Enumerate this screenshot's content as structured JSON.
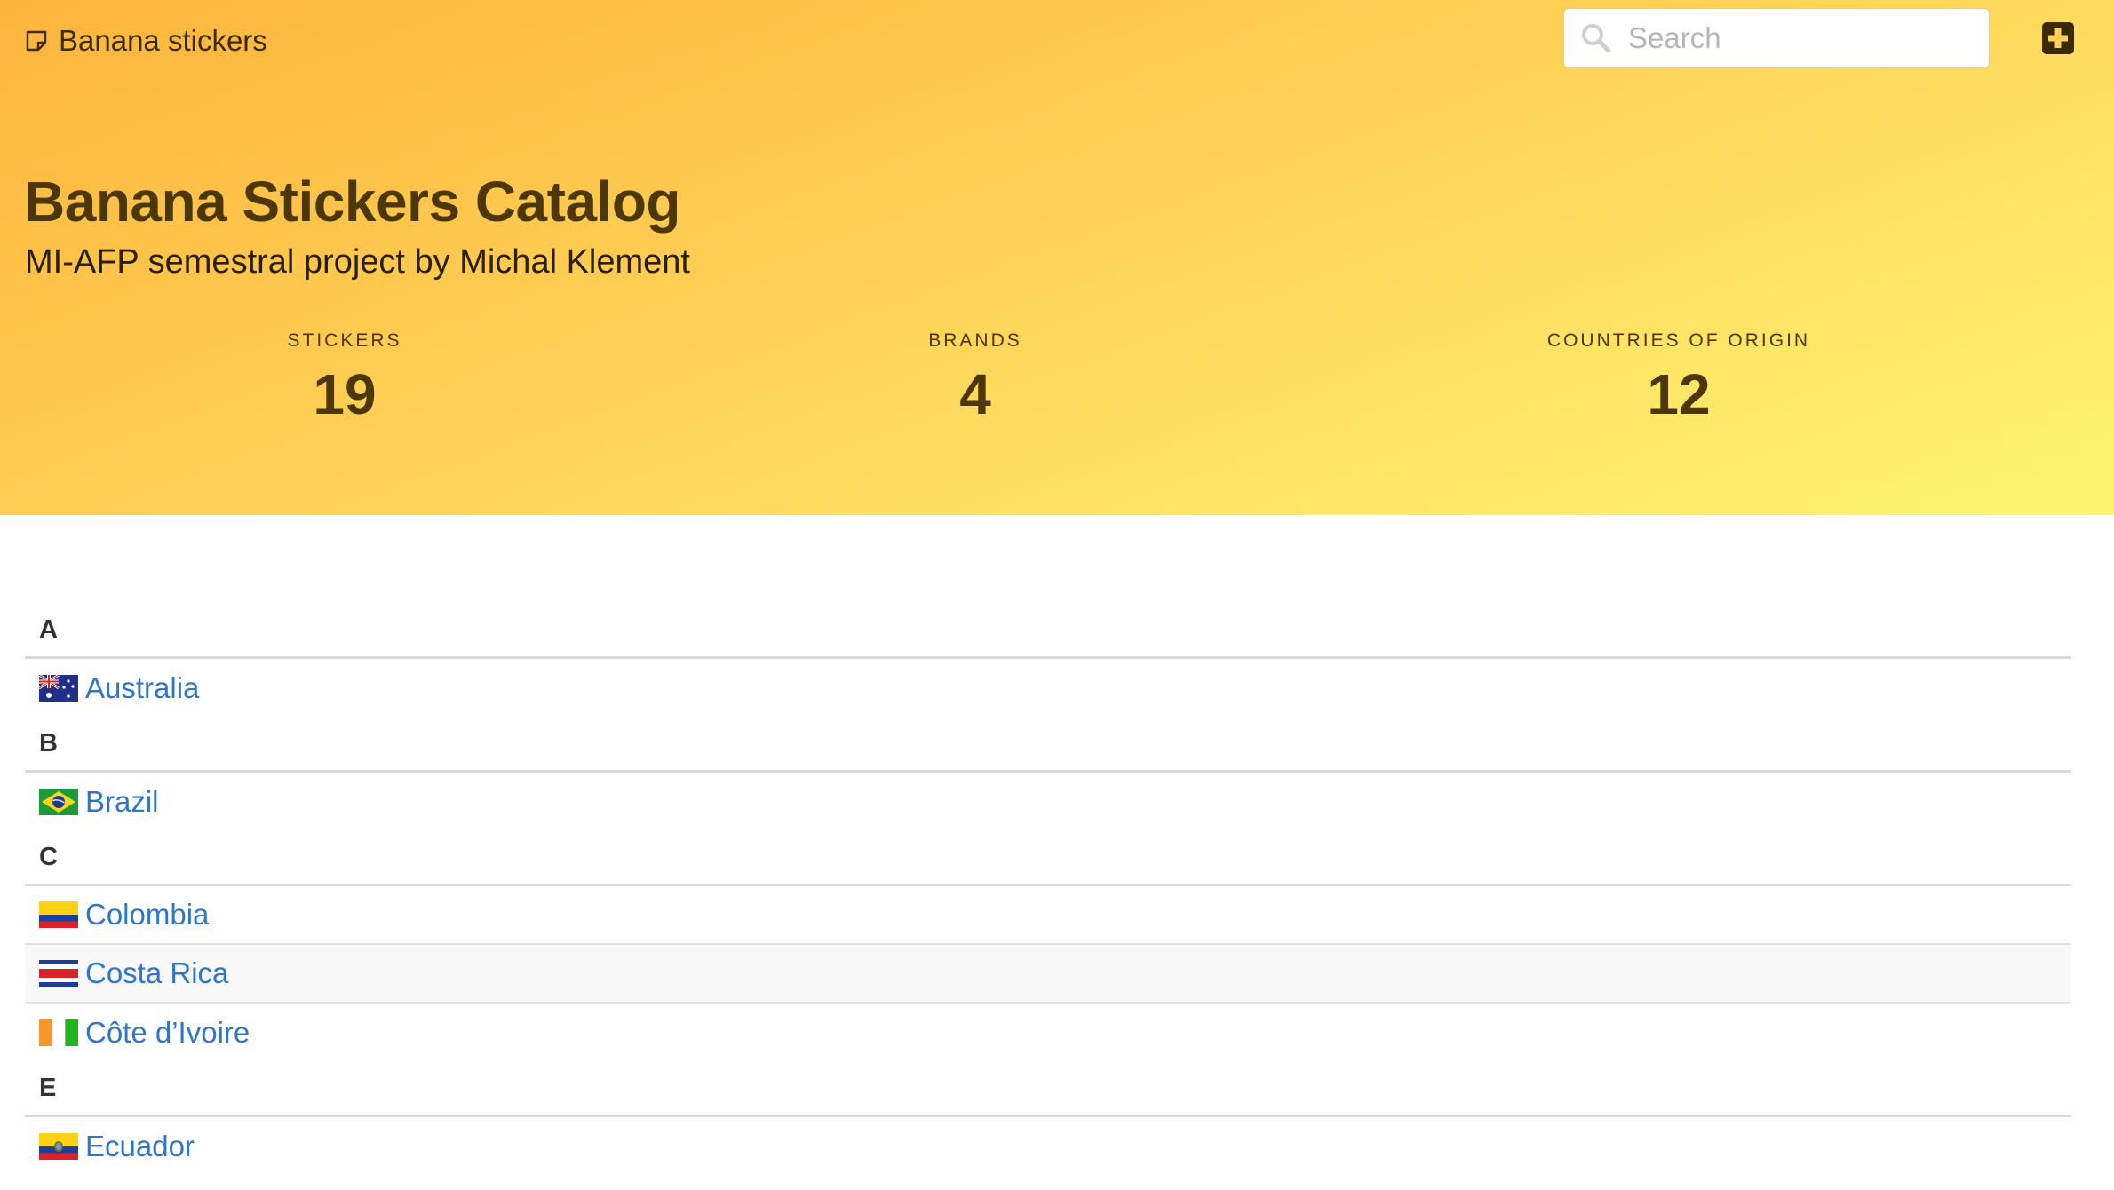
{
  "app": {
    "brand_title": "Banana stickers"
  },
  "search": {
    "placeholder": "Search"
  },
  "hero": {
    "title": "Banana Stickers Catalog",
    "subtitle": "MI-AFP semestral project by Michal Klement"
  },
  "stats": [
    {
      "label": "STICKERS",
      "value": "19"
    },
    {
      "label": "BRANDS",
      "value": "4"
    },
    {
      "label": "COUNTRIES OF ORIGIN",
      "value": "12"
    }
  ],
  "groups": [
    {
      "letter": "A",
      "countries": [
        {
          "name": "Australia",
          "flag": "australia-flag-icon"
        }
      ]
    },
    {
      "letter": "B",
      "countries": [
        {
          "name": "Brazil",
          "flag": "brazil-flag-icon"
        }
      ]
    },
    {
      "letter": "C",
      "countries": [
        {
          "name": "Colombia",
          "flag": "colombia-flag-icon"
        },
        {
          "name": "Costa Rica",
          "flag": "costa-rica-flag-icon"
        },
        {
          "name": "Côte d’Ivoire",
          "flag": "cote-divoire-flag-icon"
        }
      ]
    },
    {
      "letter": "E",
      "countries": [
        {
          "name": "Ecuador",
          "flag": "ecuador-flag-icon"
        }
      ]
    }
  ],
  "colors": {
    "gradient_start": "#fdb43c",
    "gradient_end": "#fff573",
    "heading": "#4b3708",
    "link": "#2f76c8"
  }
}
